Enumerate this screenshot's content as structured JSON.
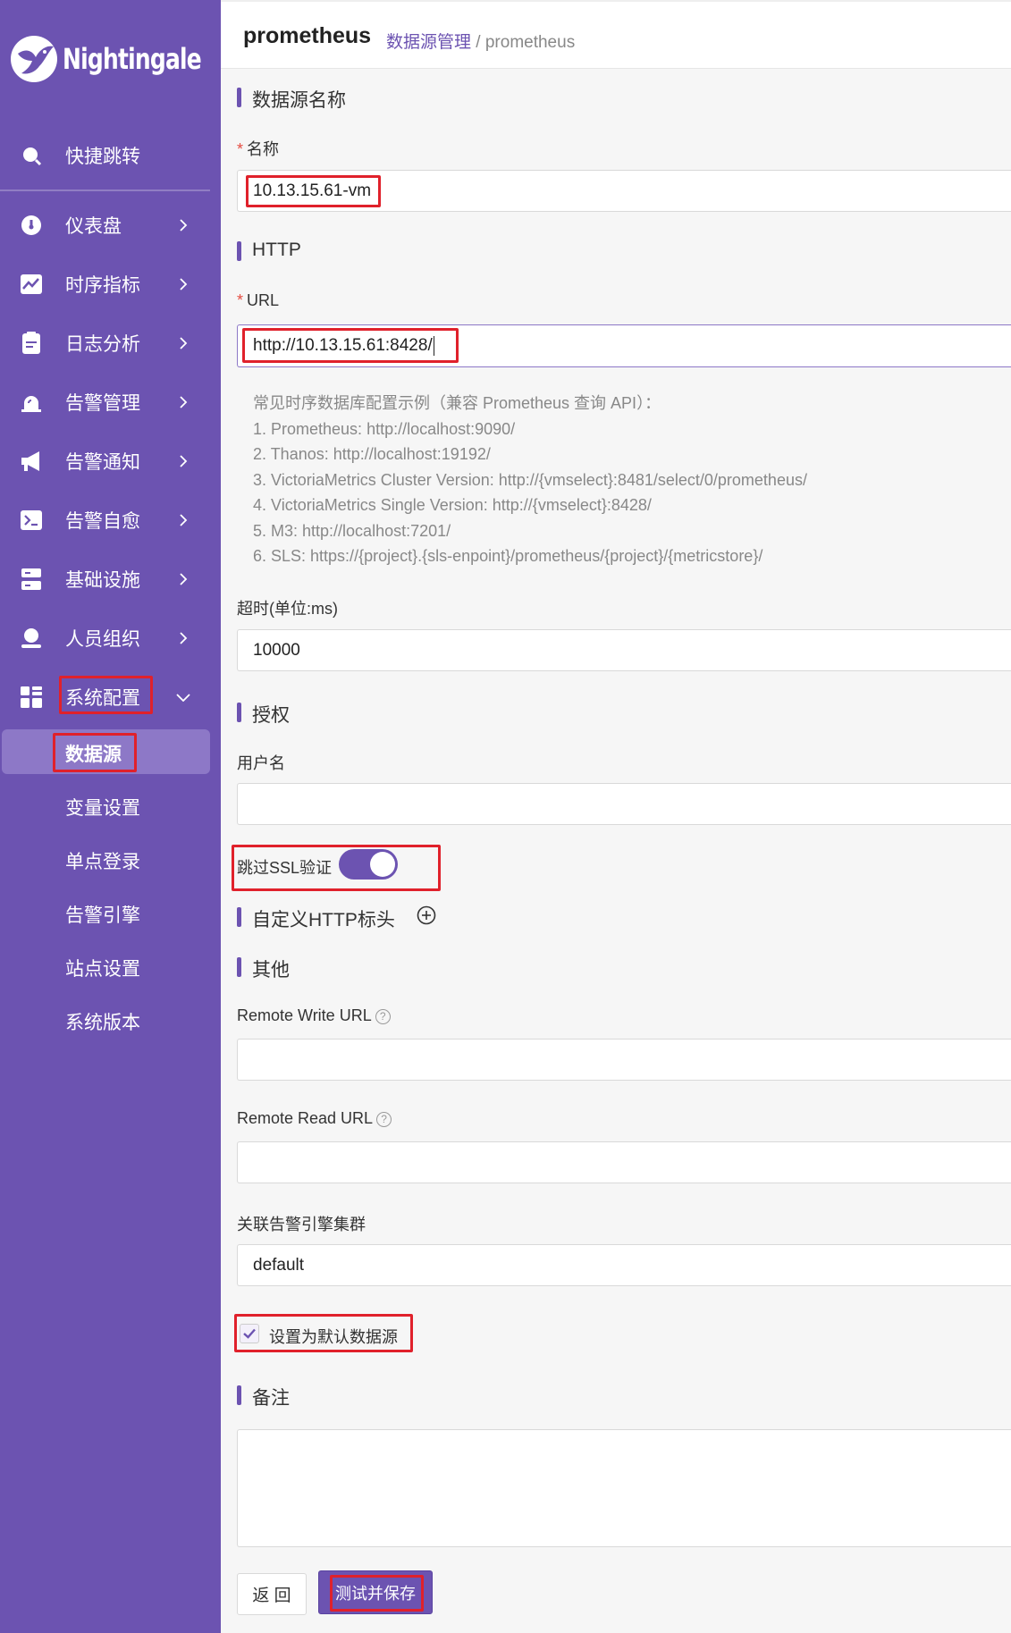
{
  "brand": {
    "name": "Nightingale"
  },
  "sidebar": {
    "quick": "快捷跳转",
    "items": [
      {
        "label": "仪表盘",
        "icon": "dashboard-icon"
      },
      {
        "label": "时序指标",
        "icon": "chart-icon"
      },
      {
        "label": "日志分析",
        "icon": "log-icon"
      },
      {
        "label": "告警管理",
        "icon": "alarm-icon"
      },
      {
        "label": "告警通知",
        "icon": "megaphone-icon"
      },
      {
        "label": "告警自愈",
        "icon": "terminal-icon"
      },
      {
        "label": "基础设施",
        "icon": "server-icon"
      },
      {
        "label": "人员组织",
        "icon": "user-icon"
      },
      {
        "label": "系统配置",
        "icon": "grid-icon"
      }
    ],
    "sub_items": [
      "数据源",
      "变量设置",
      "单点登录",
      "告警引擎",
      "站点设置",
      "系统版本"
    ]
  },
  "header": {
    "title": "prometheus",
    "breadcrumb_link": "数据源管理",
    "breadcrumb_sep": "/",
    "breadcrumb_current": "prometheus"
  },
  "form": {
    "section_name": "数据源名称",
    "name_label": "名称",
    "name_value": "10.13.15.61-vm",
    "section_http": "HTTP",
    "url_label": "URL",
    "url_value": "http://10.13.15.61:8428/",
    "hint_lines": [
      "常见时序数据库配置示例（兼容 Prometheus 查询 API）：",
      "1. Prometheus: http://localhost:9090/",
      "2. Thanos: http://localhost:19192/",
      "3. VictoriaMetrics Cluster Version: http://{vmselect}:8481/select/0/prometheus/",
      "4. VictoriaMetrics Single Version: http://{vmselect}:8428/",
      "5. M3: http://localhost:7201/",
      "6. SLS: https://{project}.{sls-enpoint}/prometheus/{project}/{metricstore}/"
    ],
    "timeout_label": "超时(单位:ms)",
    "timeout_value": "10000",
    "section_auth": "授权",
    "username_label": "用户名",
    "username_value": "",
    "skip_ssl_label": "跳过SSL验证",
    "skip_ssl_on": true,
    "section_headers": "自定义HTTP标头",
    "section_other": "其他",
    "remote_write_label": "Remote Write URL",
    "remote_read_label": "Remote Read URL",
    "help_glyph": "?",
    "cluster_label": "关联告警引擎集群",
    "cluster_value": "default",
    "default_checkbox_label": "设置为默认数据源",
    "default_checked": true,
    "section_notes": "备注",
    "back_button": "返 回",
    "save_button": "测试并保存"
  },
  "colors": {
    "sidebar": "#6c53b1",
    "accent": "#6c53b1",
    "highlight": "#e0212b"
  }
}
